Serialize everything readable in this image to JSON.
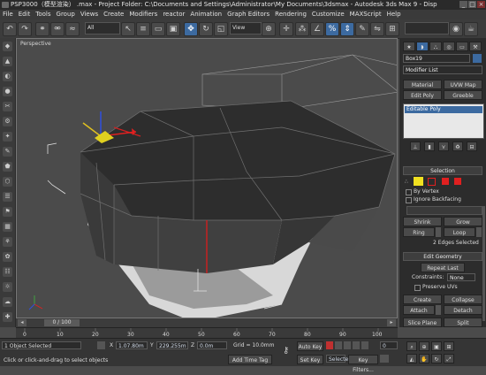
{
  "title_bar": {
    "title": "PSP3000（模型渲染） .max - Project Folder: C:\\Documents and Settings\\Administrator\\My Documents\\3dsmax - Autodesk 3ds Max 9 - Disp",
    "minimize": "_",
    "maximize": "□",
    "close": "×"
  },
  "menu": {
    "items": [
      "File",
      "Edit",
      "Tools",
      "Group",
      "Views",
      "Create",
      "Modifiers",
      "reactor",
      "Animation",
      "Graph Editors",
      "Rendering",
      "Customize",
      "MAXScript",
      "Help"
    ]
  },
  "toolbar": {
    "selection_filter": "All",
    "reference_coord": "View",
    "named_selection": ""
  },
  "viewport": {
    "label": "Perspective"
  },
  "command_panel": {
    "object_name": "Box19",
    "modifier_list": "Modifier List",
    "buttons": [
      "Material",
      "UVW Map",
      "Edit Poly",
      "Greeble"
    ],
    "stack_item": "Editable Poly",
    "selection": {
      "header": "Selection",
      "by_vertex": "By Vertex",
      "ignore_backfacing": "Ignore Backfacing",
      "shrink": "Shrink",
      "grow": "Grow",
      "ring": "Ring",
      "loop": "Loop",
      "status": "2 Edges Selected"
    },
    "edit_geometry": {
      "header": "Edit Geometry",
      "repeat_last": "Repeat Last",
      "constraints_label": "Constraints:",
      "constraints_value": "None",
      "preserve_uvs": "Preserve UVs",
      "create": "Create",
      "collapse": "Collapse",
      "attach": "Attach",
      "detach": "Detach",
      "slice_plane": "Slice Plane",
      "split": "Split"
    }
  },
  "timeline": {
    "frame": "0 / 100",
    "ticks": [
      "0",
      "10",
      "20",
      "30",
      "40",
      "50",
      "60",
      "70",
      "80",
      "90",
      "100"
    ]
  },
  "status": {
    "selection": "1 Object Selected",
    "prompt": "Click or click-and-drag to select objects",
    "x_label": "X",
    "x": "1.07.80m",
    "y_label": "Y",
    "y": "229.255m",
    "z_label": "Z",
    "z": "0.0m",
    "grid": "Grid = 10.0mm",
    "add_time_tag": "Add Time Tag",
    "auto_key": "Auto Key",
    "set_key": "Set Key",
    "selected": "Selected",
    "key_filters": "Key Filters...",
    "frame_value": "0"
  }
}
